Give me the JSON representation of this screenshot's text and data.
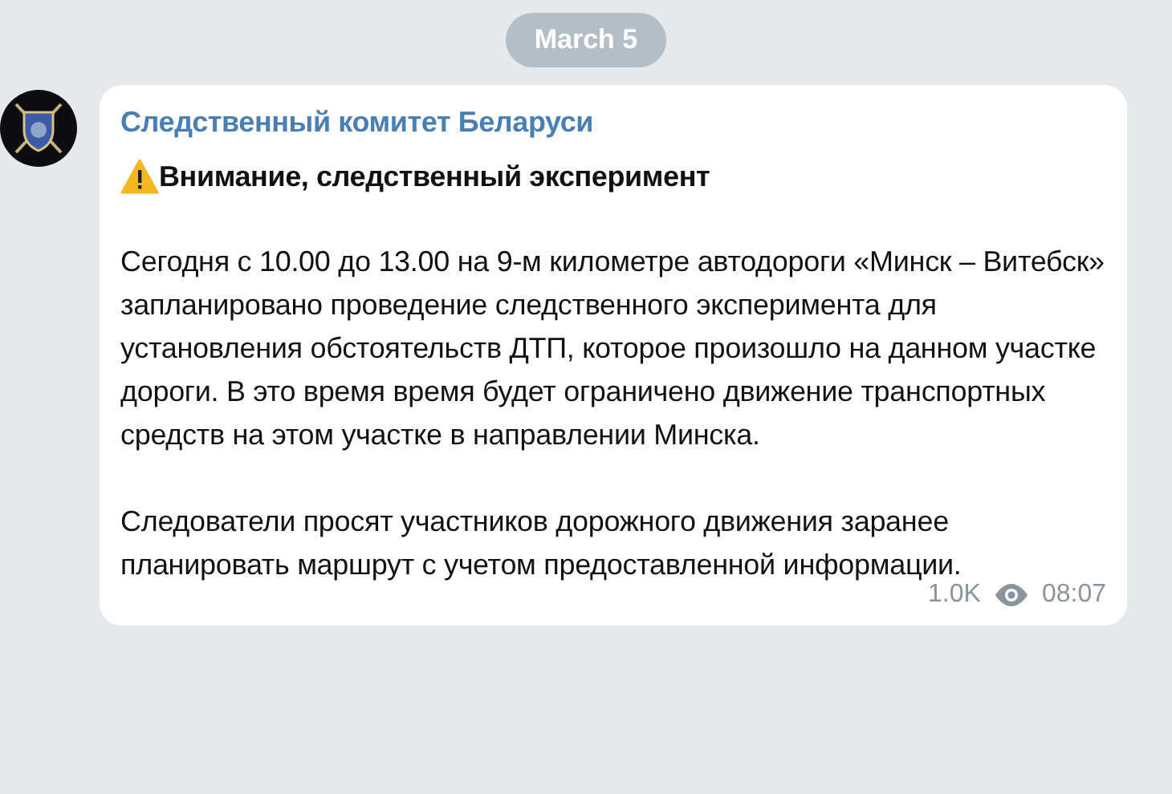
{
  "date_badge": "March 5",
  "message": {
    "sender": "Следственный комитет Беларуси",
    "title": "Внимание, следственный эксперимент",
    "paragraphs": [
      "Сегодня с 10.00 до 13.00 на 9-м километре автодороги «Минск – Витебск» запланировано проведение следственного эксперимента для установления обстоятельств ДТП, которое произошло на данном участке дороги. В это время время будет ограничено движение транспортных средств на этом участке в направлении Минска.",
      "Следователи просят участников дорожного движения заранее планировать маршрут с учетом предоставленной информации."
    ],
    "views": "1.0K",
    "time": "08:07"
  }
}
